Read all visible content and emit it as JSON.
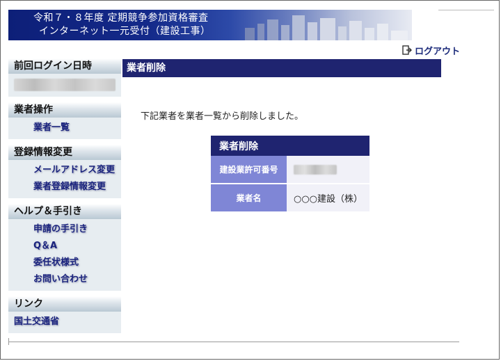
{
  "header": {
    "title_line1": "令和７・８年度 定期競争参加資格審査",
    "title_line2": "インターネット一元受付（建設工事）"
  },
  "logout": {
    "label": "ログアウト"
  },
  "sidebar": {
    "last_login": {
      "heading": "前回ログイン日時"
    },
    "operations": {
      "heading": "業者操作",
      "items": [
        "業者一覧"
      ]
    },
    "registration": {
      "heading": "登録情報変更",
      "items": [
        "メールアドレス変更",
        "業者登録情報変更"
      ]
    },
    "help": {
      "heading": "ヘルプ＆手引き",
      "items": [
        "申請の手引き",
        "Q＆A",
        "委任状様式",
        "お問い合わせ"
      ]
    },
    "links": {
      "heading": "リンク",
      "items": [
        "国土交通省"
      ]
    }
  },
  "main": {
    "title": "業者削除",
    "message": "下記業者を業者一覧から削除しました。",
    "table": {
      "caption": "業者削除",
      "rows": [
        {
          "label": "建設業許可番号"
        },
        {
          "label": "業者名",
          "value": "○○○建設（株）"
        }
      ]
    }
  },
  "colors": {
    "navy": "#1f2470",
    "row_header": "#7f86d6",
    "link": "#1a237e"
  }
}
